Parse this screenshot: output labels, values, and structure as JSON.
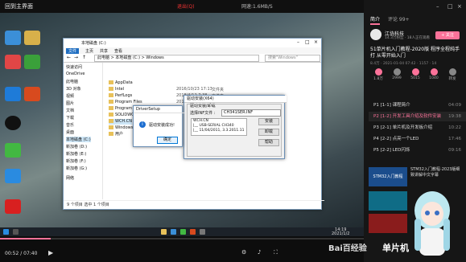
{
  "top_bar": {
    "back_label": "回到主界面",
    "red_notice": "退出(Q)",
    "watermark": "网速:1.6MB/S"
  },
  "explorer": {
    "title": "本地磁盘 (C:)",
    "ribbon_tabs": [
      "文件",
      "主页",
      "共享",
      "查看"
    ],
    "address": "此电脑 > 本地磁盘 (C:) > Windows",
    "search_placeholder": "搜索\"Windows\"",
    "nav_items": [
      "快速访问",
      "OneDrive",
      "此电脑",
      "3D 对象",
      "视频",
      "图片",
      "文档",
      "下载",
      "音乐",
      "桌面",
      "本地磁盘 (C:)",
      "新加卷 (D:)",
      "新加卷 (E:)",
      "新加卷 (F:)",
      "新加卷 (G:)",
      "网络"
    ],
    "files": [
      {
        "name": "AppData",
        "date": "",
        "type": ""
      },
      {
        "name": "Intel",
        "date": "2016/10/23 17:13",
        "type": "文件夹"
      },
      {
        "name": "PerfLogs",
        "date": "2018/4/12 7:38",
        "type": "文件夹"
      },
      {
        "name": "Program Files",
        "date": "2019/10/23 11:26",
        "type": "文件夹"
      },
      {
        "name": "Program Files (x86)",
        "date": "",
        "type": ""
      },
      {
        "name": "SOLIDWORKS Data",
        "date": "",
        "type": ""
      },
      {
        "name": "WCH.CN",
        "date": "",
        "type": ""
      },
      {
        "name": "Windows",
        "date": "",
        "type": ""
      },
      {
        "name": "用户",
        "date": "",
        "type": ""
      }
    ],
    "status": "9 个项目   选中 1 个项目"
  },
  "setup_window": {
    "title": "驱动安装(X64)",
    "group_label": "驱动安装/卸载",
    "select_label": "选择INF文件 :",
    "inf_value": "CH341SER.INF",
    "info_lines": [
      "WCH.CN",
      "|__ USB-SERIAL CH340",
      "|__ 11/04/2011, 3.3.2011.11"
    ],
    "buttons": [
      "安装",
      "卸载",
      "帮助"
    ]
  },
  "dialog": {
    "title": "DriverSetup",
    "message": "驱动安装成功!",
    "ok_label": "确定"
  },
  "taskbar": {
    "time": "14:19",
    "date": "2021/1/2"
  },
  "player": {
    "time": "00:52 / 07:40",
    "progress": 0.14,
    "watermark": "bilibili"
  },
  "panel": {
    "tabs": [
      "简介",
      "评论 99+"
    ],
    "channel": "江协科技",
    "fans": "14.3万粉丝 · 18人正在观看",
    "follow": "+ 关注",
    "video_title": "51单片机入门教程-2020版 程序全程纯手打 从零开始入门",
    "meta": "8.4万 · 2021-01-04 07:42 · 1157 · 14",
    "actions": [
      {
        "n": "1.8万"
      },
      {
        "n": "2999"
      },
      {
        "n": "5015"
      },
      {
        "n": "1040"
      },
      {
        "n": "转发"
      }
    ],
    "episodes": [
      {
        "label": "P1 [1-1] 课程简介",
        "dur": "04:09",
        "active": false
      },
      {
        "label": "P2 [1-2] 开发工具介绍及软件安装",
        "dur": "19:38",
        "active": true
      },
      {
        "label": "P3 [2-1] 单片机及开发板介绍",
        "dur": "10:22",
        "active": false
      },
      {
        "label": "P4 [2-2] 点亮一个LED",
        "dur": "17:46",
        "active": false
      },
      {
        "label": "P5 [2-2] LED闪烁",
        "dur": "09:16",
        "active": false
      }
    ],
    "rec1_label": "STM32入门教程",
    "rec1_title": "STM32入门教程-2023版细致讲解中文字幕",
    "baidu_text": "Bai百经验",
    "banner": "单片机"
  }
}
